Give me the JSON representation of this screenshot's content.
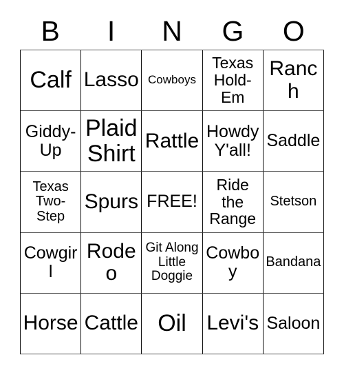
{
  "card": {
    "title": "Bingo Card",
    "headers": [
      "B",
      "I",
      "N",
      "G",
      "O"
    ],
    "rows": [
      [
        {
          "label": "Calf",
          "size": "fs-xl"
        },
        {
          "label": "Lasso",
          "size": "fs-lg"
        },
        {
          "label": "Cowboys",
          "size": "fs-tiny"
        },
        {
          "label": "Texas Hold-Em",
          "size": "fs-sm"
        },
        {
          "label": "Ranch",
          "size": "fs-lg"
        }
      ],
      [
        {
          "label": "Giddy-Up",
          "size": "fs-md"
        },
        {
          "label": "Plaid Shirt",
          "size": "fs-xl"
        },
        {
          "label": "Rattle",
          "size": "fs-lg"
        },
        {
          "label": "Howdy Y'all!",
          "size": "fs-md"
        },
        {
          "label": "Saddle",
          "size": "fs-md"
        }
      ],
      [
        {
          "label": "Texas Two-Step",
          "size": "fs-xs"
        },
        {
          "label": "Spurs",
          "size": "fs-lg"
        },
        {
          "label": "FREE!",
          "size": "fs-md"
        },
        {
          "label": "Ride the Range",
          "size": "fs-sm"
        },
        {
          "label": "Stetson",
          "size": "fs-xs"
        }
      ],
      [
        {
          "label": "Cowgirl",
          "size": "fs-md"
        },
        {
          "label": "Rodeo",
          "size": "fs-lg"
        },
        {
          "label": "Git Along Little Doggie",
          "size": "fs-xxs"
        },
        {
          "label": "Cowboy",
          "size": "fs-md"
        },
        {
          "label": "Bandana",
          "size": "fs-xs"
        }
      ],
      [
        {
          "label": "Horse",
          "size": "fs-lg"
        },
        {
          "label": "Cattle",
          "size": "fs-lg"
        },
        {
          "label": "Oil",
          "size": "fs-xl"
        },
        {
          "label": "Levi's",
          "size": "fs-lg"
        },
        {
          "label": "Saloon",
          "size": "fs-md"
        }
      ]
    ],
    "free_space_label": "FREE!",
    "colors": {
      "background": "#ffffff",
      "text": "#000000",
      "grid_line": "#111111",
      "grid_line_light": "#555555"
    }
  }
}
